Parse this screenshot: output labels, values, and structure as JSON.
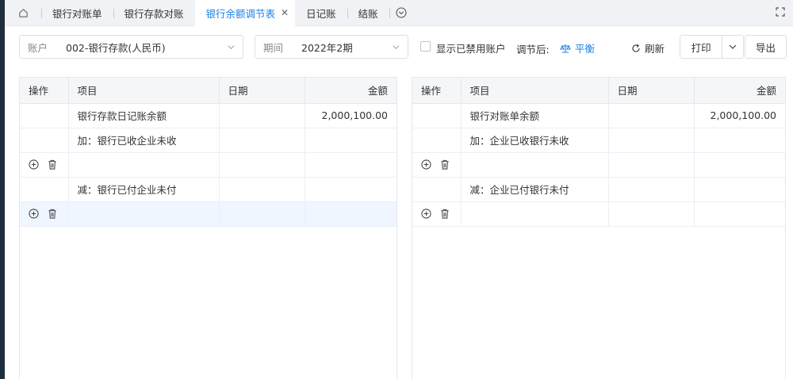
{
  "tabs": {
    "home_icon": "home-icon",
    "items": [
      "银行对账单",
      "银行存款对账",
      "银行余额调节表",
      "日记账",
      "结账"
    ],
    "active_index": 2
  },
  "filters": {
    "account_label": "账户",
    "account_value": "002-银行存款(人民币)",
    "period_label": "期间",
    "period_value": "2022年2期",
    "show_disabled_label": "显示已禁用账户",
    "show_disabled_checked": false,
    "after_adjust_label": "调节后:",
    "status": "平衡",
    "refresh_label": "刷新",
    "print_label": "打印",
    "export_label": "导出"
  },
  "left_table": {
    "headers": [
      "操作",
      "项目",
      "日期",
      "金额"
    ],
    "rows": [
      {
        "op": false,
        "item": "银行存款日记账余额",
        "date": "",
        "amount": "2,000,100.00"
      },
      {
        "op": false,
        "item": "加：银行已收企业未收",
        "date": "",
        "amount": ""
      },
      {
        "op": true,
        "item": "",
        "date": "",
        "amount": ""
      },
      {
        "op": false,
        "item": "减：银行已付企业未付",
        "date": "",
        "amount": ""
      },
      {
        "op": true,
        "item": "",
        "date": "",
        "amount": ""
      }
    ]
  },
  "right_table": {
    "headers": [
      "操作",
      "项目",
      "日期",
      "金额"
    ],
    "rows": [
      {
        "op": false,
        "item": "银行对账单余额",
        "date": "",
        "amount": "2,000,100.00"
      },
      {
        "op": false,
        "item": "加：企业已收银行未收",
        "date": "",
        "amount": ""
      },
      {
        "op": true,
        "item": "",
        "date": "",
        "amount": ""
      },
      {
        "op": false,
        "item": "减：企业已付银行未付",
        "date": "",
        "amount": ""
      },
      {
        "op": true,
        "item": "",
        "date": "",
        "amount": ""
      }
    ]
  },
  "colors": {
    "accent": "#1a7fe6",
    "nav": "#1f2d3d"
  }
}
